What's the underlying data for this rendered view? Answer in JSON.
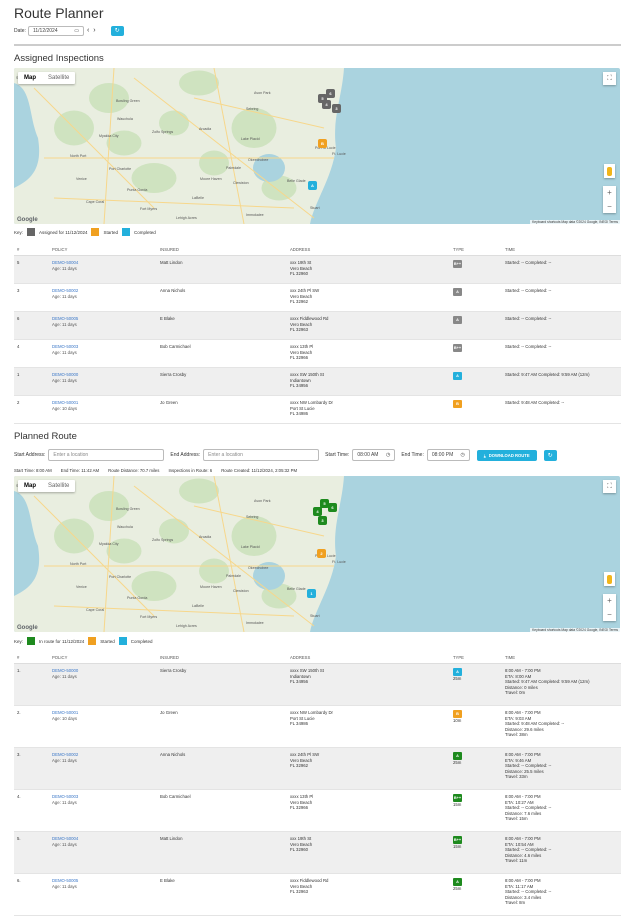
{
  "page": {
    "title": "Route Planner"
  },
  "date_picker": {
    "label": "Date:",
    "value": "11/12/2024"
  },
  "assigned": {
    "heading": "Assigned Inspections",
    "key": {
      "label": "Key:",
      "assigned": "Assigned for 11/12/2024",
      "started": "Started",
      "completed": "Completed"
    },
    "columns": [
      "#",
      "POLICY",
      "INSURED",
      "ADDRESS",
      "TYPE",
      "TIME"
    ],
    "rows": [
      {
        "num": "5",
        "policy": "DEMO-50004",
        "age": "Age: 11 days",
        "insured": "Matt Lindon",
        "addr1": "xxx 19th St",
        "addr2": "Vero Beach",
        "addr3": "FL 32960",
        "type": "B++",
        "type_color": "#888888",
        "time": "Started: -- Completed: --"
      },
      {
        "num": "3",
        "policy": "DEMO-50002",
        "age": "Age: 11 days",
        "insured": "Anna Nichols",
        "addr1": "xxx 24th Pl SW",
        "addr2": "Vero Beach",
        "addr3": "FL 32962",
        "type": "A",
        "type_color": "#888888",
        "time": "Started: -- Completed: --"
      },
      {
        "num": "6",
        "policy": "DEMO-50005",
        "age": "Age: 11 days",
        "insured": "E Blake",
        "addr1": "xxxx Fiddlewood Rd",
        "addr2": "Vero Beach",
        "addr3": "FL 32963",
        "type": "A",
        "type_color": "#888888",
        "time": "Started: -- Completed: --"
      },
      {
        "num": "4",
        "policy": "DEMO-50003",
        "age": "Age: 11 days",
        "insured": "Bob Carmichael",
        "addr1": "xxxx 13th Pl",
        "addr2": "Vero Beach",
        "addr3": "FL 32966",
        "type": "B++",
        "type_color": "#888888",
        "time": "Started: -- Completed: --"
      },
      {
        "num": "1",
        "policy": "DEMO-50000",
        "age": "Age: 11 days",
        "insured": "Sierra Crosby",
        "addr1": "xxxx SW 150th St",
        "addr2": "Indiantown",
        "addr3": "FL 34956",
        "type": "A",
        "type_color": "#23b0dc",
        "time": "Started: 9:47 AM Completed: 9:59 AM (12m)"
      },
      {
        "num": "2",
        "policy": "DEMO-50001",
        "age": "Age: 10 days",
        "insured": "Jo Green",
        "addr1": "xxxx NW Lombardy Dr",
        "addr2": "Port St Lucie",
        "addr3": "FL 34986",
        "type": "B",
        "type_color": "#f0a020",
        "time": "Started: 9:48 AM Completed: --"
      }
    ]
  },
  "planned": {
    "heading": "Planned Route",
    "start_label": "Start Address:",
    "start_placeholder": "Enter a location",
    "end_label": "End Address:",
    "end_placeholder": "Enter a location",
    "start_time_label": "Start Time:",
    "start_time": "08:00 AM",
    "end_time_label": "End Time:",
    "end_time": "08:00 PM",
    "download_label": "DOWNLOAD ROUTE",
    "stats": {
      "start": "Start Time: 8:00 AM",
      "end": "End Time: 11:42 AM",
      "distance": "Route Distance: 70.7 miles",
      "inspections": "Inspections in Route: 6",
      "created": "Route Created: 11/12/2024, 2:05:32 PM"
    },
    "key": {
      "label": "Key:",
      "in_route": "In route for 11/12/2024",
      "started": "Started",
      "completed": "Completed"
    },
    "columns": [
      "#",
      "POLICY",
      "INSURED",
      "ADDRESS",
      "TYPE",
      "TIME"
    ],
    "rows": [
      {
        "num": "1.",
        "policy": "DEMO-50000",
        "age": "Age: 11 days",
        "insured": "Sierra Crosby",
        "addr1": "xxxx SW 150th St",
        "addr2": "Indiantown",
        "addr3": "FL 34956",
        "type": "A",
        "type_color": "#23b0dc",
        "dur": "25m",
        "t": [
          "8:00 AM - 7:00 PM",
          "ETA: 8:00 AM",
          "Started: 9:47 AM Completed: 9:59 AM (12m)",
          "Distance: 0 miles",
          "Travel: 0m"
        ]
      },
      {
        "num": "2.",
        "policy": "DEMO-50001",
        "age": "Age: 10 days",
        "insured": "Jo Green",
        "addr1": "xxxx NW Lombardy Dr",
        "addr2": "Port St Lucie",
        "addr3": "FL 34986",
        "type": "B",
        "type_color": "#f0a020",
        "dur": "10m",
        "t": [
          "8:00 AM - 7:00 PM",
          "ETA: 9:03 AM",
          "Started: 9:48 AM Completed: --",
          "Distance: 29.6 miles",
          "Travel: 38m"
        ]
      },
      {
        "num": "3.",
        "policy": "DEMO-50002",
        "age": "Age: 11 days",
        "insured": "Anna Nichols",
        "addr1": "xxx 24th Pl SW",
        "addr2": "Vero Beach",
        "addr3": "FL 32962",
        "type": "A",
        "type_color": "#1e8a1e",
        "dur": "25m",
        "t": [
          "8:00 AM - 7:00 PM",
          "ETA: 9:46 AM",
          "Started: -- Completed: --",
          "Distance: 25.5 miles",
          "Travel: 33m"
        ]
      },
      {
        "num": "4.",
        "policy": "DEMO-50003",
        "age": "Age: 11 days",
        "insured": "Bob Carmichael",
        "addr1": "xxxx 13th Pl",
        "addr2": "Vero Beach",
        "addr3": "FL 32966",
        "type": "B++",
        "type_color": "#1e8a1e",
        "dur": "15m",
        "t": [
          "8:00 AM - 7:00 PM",
          "ETA: 10:27 AM",
          "Started: -- Completed: --",
          "Distance: 7.6 miles",
          "Travel: 15m"
        ]
      },
      {
        "num": "5.",
        "policy": "DEMO-50004",
        "age": "Age: 11 days",
        "insured": "Matt Lindon",
        "addr1": "xxx 19th St",
        "addr2": "Vero Beach",
        "addr3": "FL 32960",
        "type": "B++",
        "type_color": "#1e8a1e",
        "dur": "15m",
        "t": [
          "8:00 AM - 7:00 PM",
          "ETA: 10:54 AM",
          "Started: -- Completed: --",
          "Distance: 4.6 miles",
          "Travel: 11m"
        ]
      },
      {
        "num": "6.",
        "policy": "DEMO-50005",
        "age": "Age: 11 days",
        "insured": "E Blake",
        "addr1": "xxxx Fiddlewood Rd",
        "addr2": "Vero Beach",
        "addr3": "FL 32963",
        "type": "A",
        "type_color": "#1e8a1e",
        "dur": "25m",
        "t": [
          "8:00 AM - 7:00 PM",
          "ETA: 11:17 AM",
          "Started: -- Completed: --",
          "Distance: 3.4 miles",
          "Travel: 8m"
        ]
      }
    ]
  },
  "map": {
    "tab_map": "Map",
    "tab_satellite": "Satellite",
    "google": "Google",
    "attribution": "Keyboard shortcuts   Map data ©2024 Google, INEGI   Terms",
    "labels": [
      "St. Petersburg",
      "Bowling Green",
      "Wauchula",
      "Myakka City",
      "Arcadia",
      "Lake Placid",
      "Port St Lucie",
      "Okeechobee",
      "Clewiston",
      "Moore Haven",
      "Punta Gorda",
      "North Port",
      "Cape Coral",
      "Fort Myers",
      "Sebring",
      "Avon Park",
      "Stuart",
      "Lehigh Acres",
      "Immokalee",
      "Belle Glade",
      "Ft. Lucie",
      "Port Charlotte",
      "Zolfo Springs",
      "Venice",
      "LaBelle",
      "Palmdale"
    ],
    "pins_assigned": [
      "A",
      "B",
      "A"
    ],
    "pins_planned": [
      "1",
      "2",
      "3",
      "4",
      "5",
      "6"
    ],
    "colors": {
      "assigned": "#666666",
      "started": "#f0a020",
      "completed": "#23b0dc",
      "in_route": "#1e8a1e"
    }
  }
}
